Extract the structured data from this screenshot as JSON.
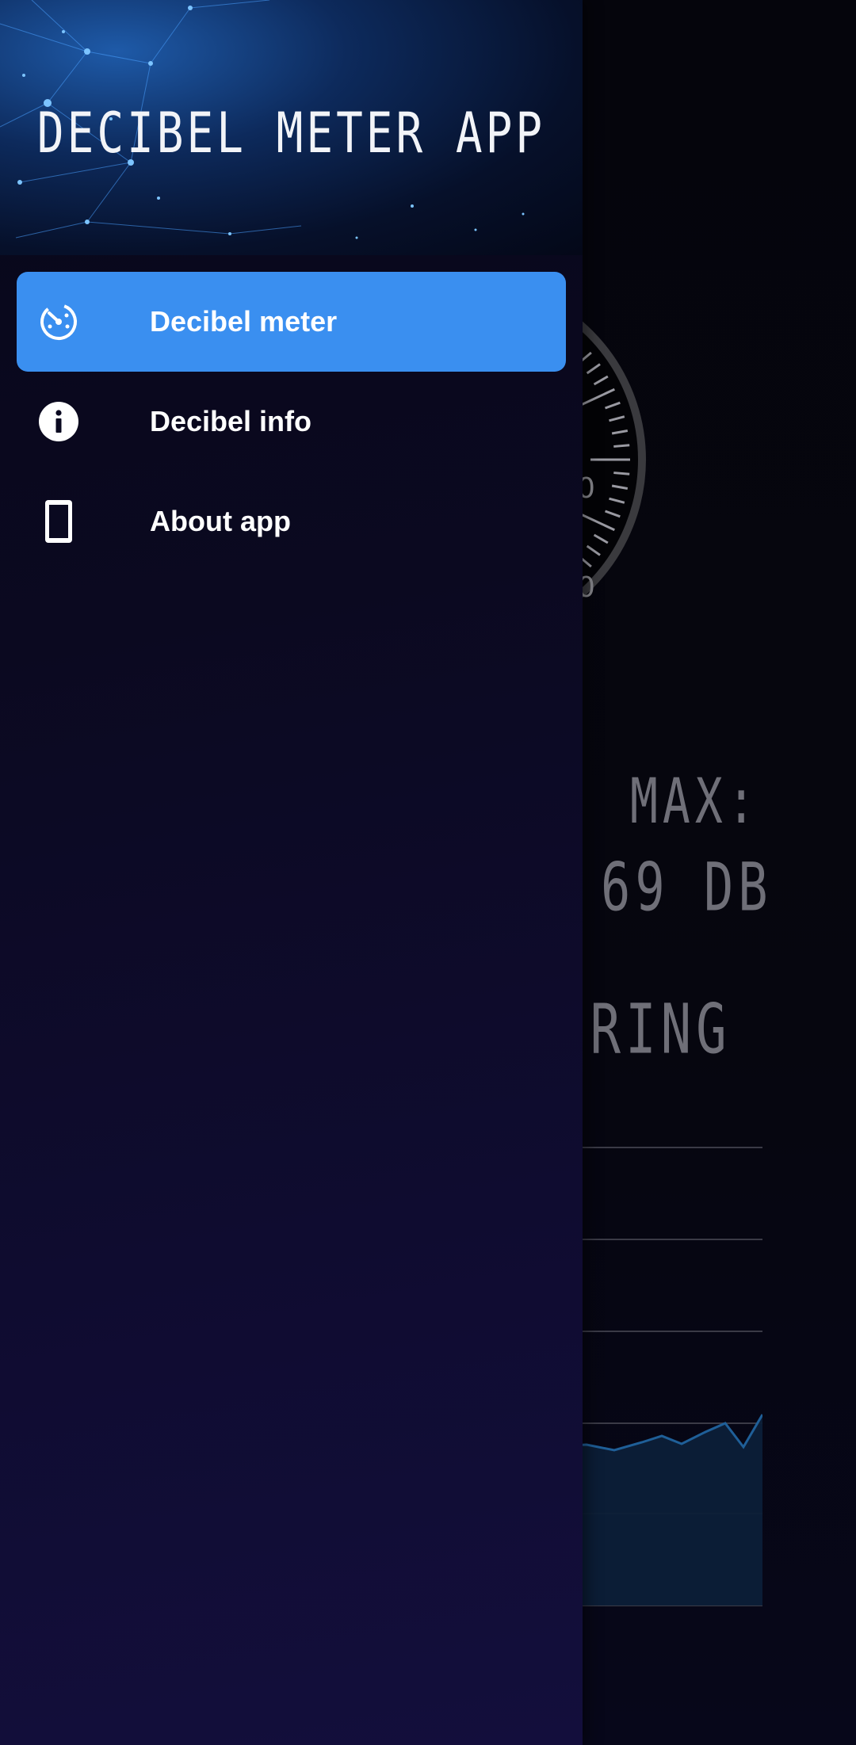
{
  "app": {
    "title": "DECIBEL METER APP"
  },
  "drawer": {
    "items": [
      {
        "label": "Decibel meter",
        "icon": "gauge-icon",
        "active": true
      },
      {
        "label": "Decibel info",
        "icon": "info-icon",
        "active": false
      },
      {
        "label": "About app",
        "icon": "phone-icon",
        "active": false
      }
    ]
  },
  "background": {
    "gauge_partial_labels": [
      "0",
      "0"
    ],
    "max_label": "MAX:",
    "max_value": "69 DB",
    "status_partial": "ORING"
  },
  "colors": {
    "accent": "#3A8FF0",
    "drawer_top": "#07071A",
    "drawer_bottom": "#130E3C",
    "lcd_text": "#6F6F78"
  }
}
